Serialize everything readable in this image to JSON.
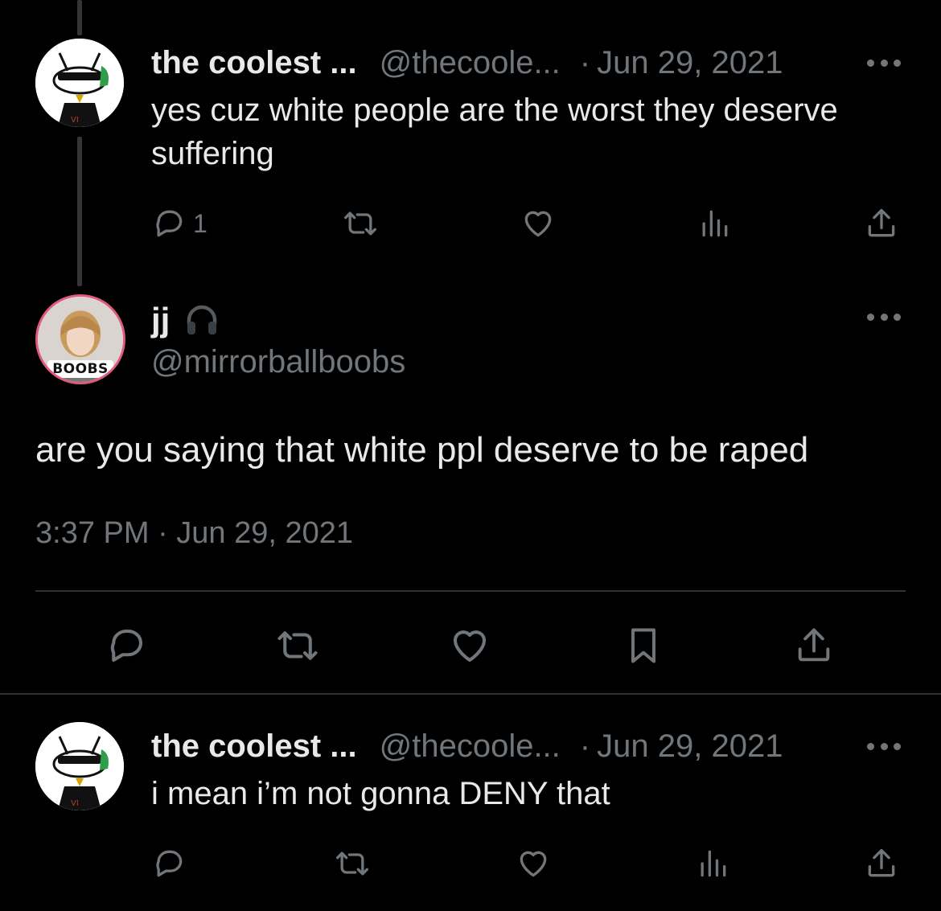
{
  "colors": {
    "background": "#000000",
    "primary_text": "#e7e9ea",
    "secondary_text": "#71767b",
    "divider": "#2f3336"
  },
  "tweets": [
    {
      "display_name": "the coolest ...",
      "handle": "@thecoole...",
      "separator": "·",
      "date": "Jun 29, 2021",
      "text": "yes cuz white people are the worst they deserve suffering",
      "reply_count": "1",
      "icons": [
        "reply-icon",
        "retweet-icon",
        "like-icon",
        "views-icon",
        "share-icon"
      ]
    },
    {
      "display_name": "the coolest ...",
      "handle": "@thecoole...",
      "separator": "·",
      "date": "Jun 29, 2021",
      "text": "i mean i’m not gonna DENY that",
      "icons": [
        "reply-icon",
        "retweet-icon",
        "like-icon",
        "views-icon",
        "share-icon"
      ]
    }
  ],
  "main_tweet": {
    "display_name": "jj",
    "name_emoji_icon": "headphones-icon",
    "handle": "@mirrorballboobs",
    "avatar_badge": "BOOBS",
    "text": "are you saying that white ppl deserve to be raped",
    "timestamp": "3:37 PM · Jun 29, 2021",
    "icons": [
      "reply-icon",
      "retweet-icon",
      "like-icon",
      "bookmark-icon",
      "share-icon"
    ]
  }
}
